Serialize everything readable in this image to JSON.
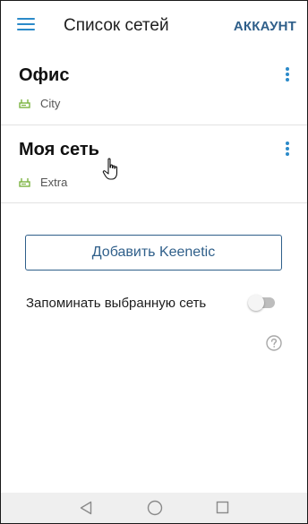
{
  "header": {
    "title": "Список сетей",
    "account_label": "АККАУНТ",
    "menu_icon": "hamburger-menu-icon"
  },
  "networks": [
    {
      "name": "Офис",
      "status": "City",
      "icon": "router-icon"
    },
    {
      "name": "Моя сеть",
      "status": "Extra",
      "icon": "router-icon"
    }
  ],
  "actions": {
    "add_button_label": "Добавить Keenetic"
  },
  "settings": {
    "remember_label": "Запоминать выбранную сеть",
    "remember_enabled": false
  },
  "colors": {
    "accent": "#2b8ac9",
    "brand_dark_blue": "#2f5f8a",
    "router_icon_green": "#7cb342",
    "divider": "#e2e2e2"
  }
}
